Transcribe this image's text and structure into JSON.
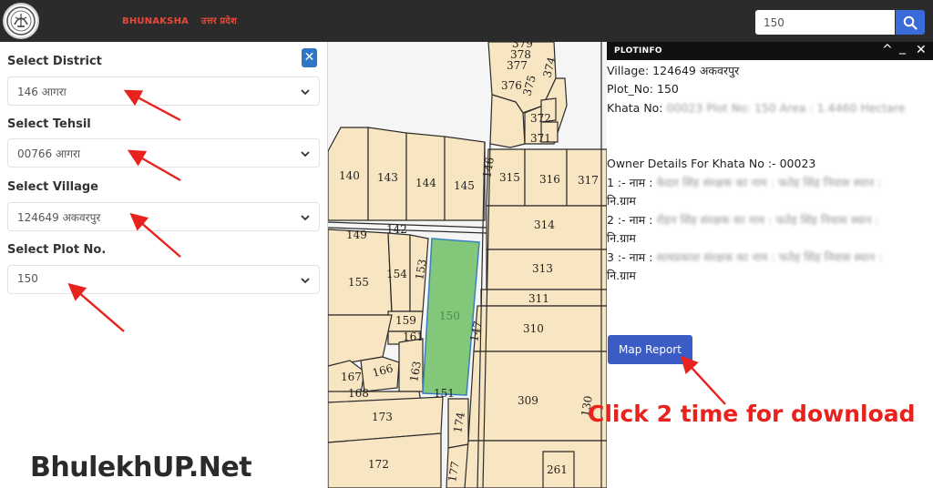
{
  "header": {
    "brand_primary": "BHUNAKSHA",
    "brand_secondary": "उत्तर प्रदेश",
    "search_value": "150",
    "icons": {
      "logo": "up-government-emblem",
      "search": "search-icon"
    }
  },
  "left_panel": {
    "close_label": "✕",
    "fields": [
      {
        "label": "Select District",
        "value": "146 आगरा"
      },
      {
        "label": "Select Tehsil",
        "value": "00766 आगरा"
      },
      {
        "label": "Select Village",
        "value": "124649 अकवरपुर"
      },
      {
        "label": "Select Plot No.",
        "value": "150"
      }
    ]
  },
  "map": {
    "selected_plot": "150",
    "plot_labels": [
      "379",
      "378",
      "377",
      "376",
      "375",
      "374",
      "372",
      "371",
      "140",
      "143",
      "144",
      "145",
      "146",
      "315",
      "316",
      "317",
      "314",
      "149",
      "142",
      "155",
      "154",
      "153",
      "313",
      "311",
      "310",
      "159",
      "161",
      "147",
      "167",
      "166",
      "163",
      "168",
      "151",
      "309",
      "173",
      "174",
      "130",
      "172",
      "177",
      "261"
    ],
    "colors": {
      "parcel_fill": "#f8e6c2",
      "selected_fill": "#82c77a",
      "boundary": "#2b2b2b",
      "background": "#f5f5f5"
    }
  },
  "plot_info": {
    "title": "PLOTINFO",
    "controls": [
      "^",
      "_",
      "✕"
    ],
    "village": "Village: 124649 अकवरपुर",
    "plot_no": "Plot_No: 150",
    "khata_prefix": "Khata No:",
    "khata_blurred": "00023 Plot No: 150 Area : 1.4460 Hectare",
    "owner_heading": "Owner Details For Khata No :- 00023",
    "owners": [
      {
        "prefix": "1 :- नाम :",
        "blurred": "केदार सिंह संरक्षक का नाम : फतेह सिंह निवास स्थान :",
        "suffix": "नि.ग्राम"
      },
      {
        "prefix": "2 :- नाम :",
        "blurred": "रोहन सिंह संरक्षक का नाम : फतेह सिंह निवास स्थान :",
        "suffix": "नि.ग्राम"
      },
      {
        "prefix": "3 :- नाम :",
        "blurred": "सत्यप्रकाश संरक्षक का नाम : फतेह सिंह निवास स्थान :",
        "suffix": "नि.ग्राम"
      }
    ],
    "map_report_label": "Map Report"
  },
  "annotations": {
    "instruction": "Click 2 time for download",
    "watermark": "BhulekhUP.Net",
    "arrow_color": "#e8231e"
  }
}
